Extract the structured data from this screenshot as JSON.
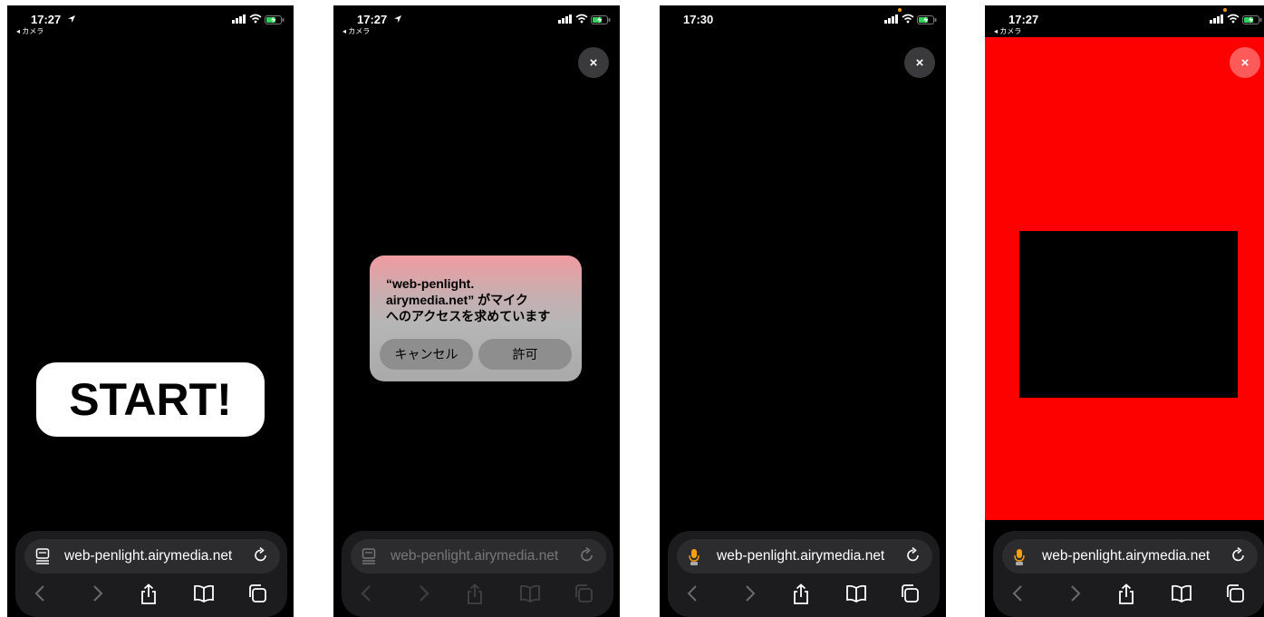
{
  "status": {
    "time_1": "17:27",
    "time_2": "17:27",
    "time_3": "17:30",
    "time_4": "17:27",
    "back_label": "◂ カメラ"
  },
  "screen1": {
    "start_label": "START!"
  },
  "screen2": {
    "dialog_message": "“web-penlight.\nairymedia.net” がマイク\nへのアクセスを求めています",
    "cancel_label": "キャンセル",
    "allow_label": "許可"
  },
  "close_label": "×",
  "url": "web-penlight.airymedia.net",
  "colors": {
    "toolbar_bg": "#1c1c1e",
    "urlbar_bg": "#2c2c2e",
    "red": "#fd0000",
    "mic_orange": "#ff9f0a",
    "battery_green": "#30d158"
  },
  "icons": [
    "page-icon",
    "mic-icon",
    "reload-icon",
    "back-icon",
    "forward-icon",
    "share-icon",
    "bookmarks-icon",
    "tabs-icon",
    "signal-icon",
    "wifi-icon",
    "battery-icon",
    "location-arrow-icon"
  ]
}
